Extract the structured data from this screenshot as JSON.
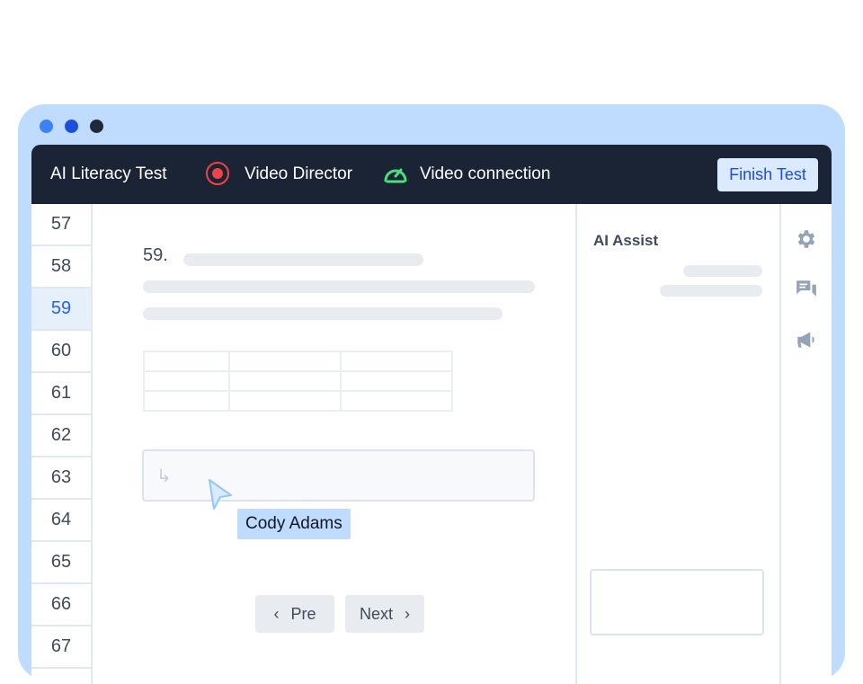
{
  "window": {
    "controls": [
      {
        "name": "dot-1",
        "color": "#3b82f6"
      },
      {
        "name": "dot-2",
        "color": "#1d4ed8"
      },
      {
        "name": "dot-3",
        "color": "#1e293b"
      }
    ]
  },
  "header": {
    "app_title": "AI Literacy Test",
    "record_icon": "record-icon",
    "record_label": "Video Director",
    "connection_icon": "gauge-icon",
    "connection_label": "Video connection",
    "finish_label": "Finish Test"
  },
  "question_nav": {
    "items": [
      "57",
      "58",
      "59",
      "60",
      "61",
      "62",
      "63",
      "64",
      "65",
      "66",
      "67"
    ],
    "active": "59"
  },
  "question": {
    "number": "59.",
    "answer_icon": "reply-arrow-icon",
    "prev_label": "Pre",
    "next_label": "Next"
  },
  "assist": {
    "title": "AI Assist"
  },
  "right_toolbar": {
    "icons": [
      "gear-icon",
      "chat-icon",
      "megaphone-icon"
    ]
  },
  "collaborator": {
    "name": "Cody Adams"
  },
  "colors": {
    "frame": "#bfdbfe",
    "topbar": "#1b2435",
    "accent": "#2563eb",
    "record": "#ef4444",
    "connection": "#4ade80"
  }
}
